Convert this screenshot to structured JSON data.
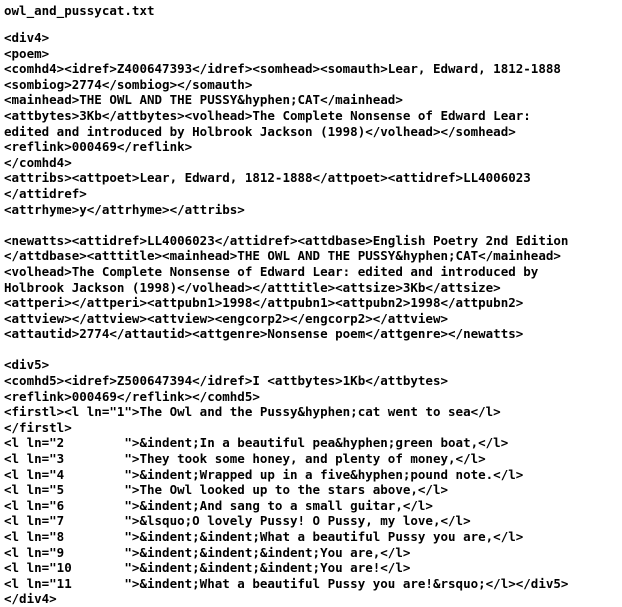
{
  "document": {
    "filename": "owl_and_pussycat.txt",
    "text_color": "#000000",
    "background_color": "#ffffff",
    "lines": [
      "<div4>",
      "<poem>",
      "<comhd4><idref>Z400647393</idref><somhead><somauth>Lear, Edward, 1812-1888",
      "<sombiog>2774</sombiog></somauth>",
      "<mainhead>THE OWL AND THE PUSSY&hyphen;CAT</mainhead>",
      "<attbytes>3Kb</attbytes><volhead>The Complete Nonsense of Edward Lear:",
      "edited and introduced by Holbrook Jackson (1998)</volhead></somhead>",
      "<reflink>000469</reflink>",
      "</comhd4>",
      "<attribs><attpoet>Lear, Edward, 1812-1888</attpoet><attidref>LL4006023",
      "</attidref>",
      "<attrhyme>y</attrhyme></attribs>",
      "",
      "<newatts><attidref>LL4006023</attidref><attdbase>English Poetry 2nd Edition",
      "</attdbase><atttitle><mainhead>THE OWL AND THE PUSSY&hyphen;CAT</mainhead>",
      "<volhead>The Complete Nonsense of Edward Lear: edited and introduced by",
      "Holbrook Jackson (1998)</volhead></atttitle><attsize>3Kb</attsize>",
      "<attperi></attperi><attpubn1>1998</attpubn1><attpubn2>1998</attpubn2>",
      "<attview></attview><attview><engcorp2></engcorp2></attview>",
      "<attautid>2774</attautid><attgenre>Nonsense poem</attgenre></newatts>",
      "",
      "<div5>",
      "<comhd5><idref>Z500647394</idref>I <attbytes>1Kb</attbytes>",
      "<reflink>000469</reflink></comhd5>",
      "<firstl><l ln=\"1\">The Owl and the Pussy&hyphen;cat went to sea</l>",
      "</firstl>",
      "<l ln=\"2        \">&indent;In a beautiful pea&hyphen;green boat,</l>",
      "<l ln=\"3        \">They took some honey, and plenty of money,</l>",
      "<l ln=\"4        \">&indent;Wrapped up in a five&hyphen;pound note.</l>",
      "<l ln=\"5        \">The Owl looked up to the stars above,</l>",
      "<l ln=\"6        \">&indent;And sang to a small guitar,</l>",
      "<l ln=\"7        \">&lsquo;O lovely Pussy! O Pussy, my love,</l>",
      "<l ln=\"8        \">&indent;&indent;What a beautiful Pussy you are,</l>",
      "<l ln=\"9        \">&indent;&indent;&indent;You are,</l>",
      "<l ln=\"10       \">&indent;&indent;&indent;You are!</l>",
      "<l ln=\"11       \">&indent;What a beautiful Pussy you are!&rsquo;</l></div5>",
      "</div4>"
    ]
  }
}
